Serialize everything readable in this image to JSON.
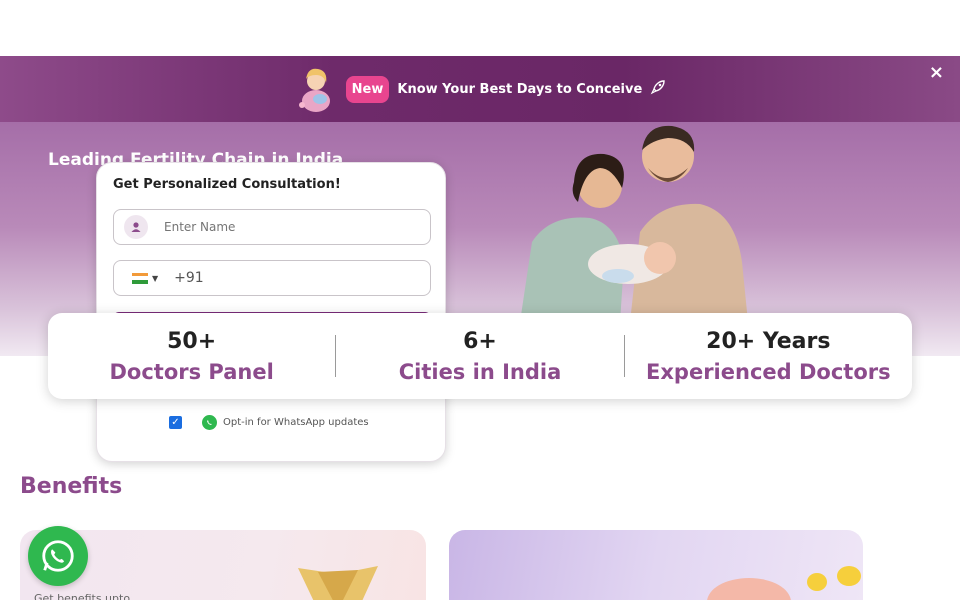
{
  "promo": {
    "badge": "New",
    "text": "Know Your Best Days to Conceive",
    "rocket_icon": "rocket-icon",
    "close_label": "×"
  },
  "hero": {
    "heading": "Leading Fertility Chain in India"
  },
  "form": {
    "title": "Get Personalized Consultation!",
    "name_placeholder": "Enter Name",
    "phone_prefix": "+91",
    "country_flag": "india-flag-icon",
    "optin_checked": true,
    "optin_label": "Opt-in for WhatsApp updates"
  },
  "stats": [
    {
      "value": "50+",
      "label": "Doctors Panel"
    },
    {
      "value": "6+",
      "label": "Cities in India"
    },
    {
      "value": "20+ Years",
      "label": "Experienced Doctors"
    }
  ],
  "benefits": {
    "title": "Benefits",
    "card1_text": "Get benefits upto"
  },
  "colors": {
    "brand_purple": "#8c4b8c",
    "new_badge": "#e8458f",
    "whatsapp": "#2fb84f"
  }
}
